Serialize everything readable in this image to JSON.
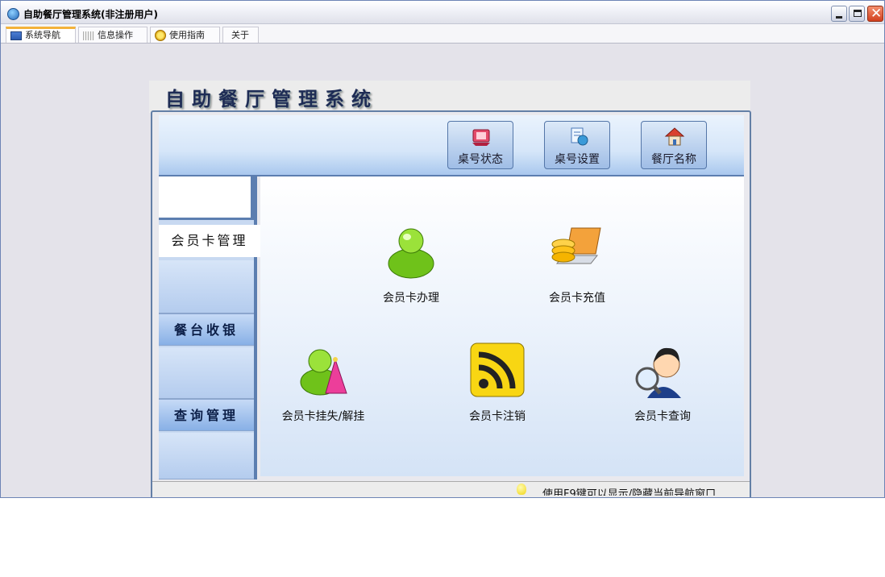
{
  "window": {
    "title": "自助餐厅管理系统(非注册用户)"
  },
  "tabs": [
    {
      "label": "系统导航",
      "icon": "nav-icon",
      "active": true
    },
    {
      "label": "信息操作",
      "icon": "grid-icon",
      "active": false
    },
    {
      "label": "使用指南",
      "icon": "guide-icon",
      "active": false
    },
    {
      "label": "关于",
      "icon": "",
      "active": false
    }
  ],
  "app": {
    "title": "自助餐厅管理系统"
  },
  "toolbar": {
    "buttons": [
      {
        "label": "桌号状态",
        "icon": "table-status-icon"
      },
      {
        "label": "桌号设置",
        "icon": "table-settings-icon"
      },
      {
        "label": "餐厅名称",
        "icon": "restaurant-name-icon"
      }
    ]
  },
  "nav": {
    "items": [
      {
        "label": "会员卡管理",
        "active": true
      },
      {
        "label": "餐台收银",
        "active": false
      },
      {
        "label": "查询管理",
        "active": false
      }
    ]
  },
  "features": [
    {
      "label": "会员卡办理",
      "icon": "member-user-icon"
    },
    {
      "label": "会员卡充值",
      "icon": "coins-laptop-icon"
    },
    {
      "label": "会员卡挂失/解挂",
      "icon": "member-lost-icon"
    },
    {
      "label": "会员卡注销",
      "icon": "rss-cancel-icon"
    },
    {
      "label": "会员卡查询",
      "icon": "magnifier-person-icon"
    }
  ],
  "status": {
    "text": "使用F9键可以显示/隐藏当前导航窗口"
  },
  "colors": {
    "accent_tab": "#f3b23a",
    "frame_blue": "#5c7eb0"
  }
}
